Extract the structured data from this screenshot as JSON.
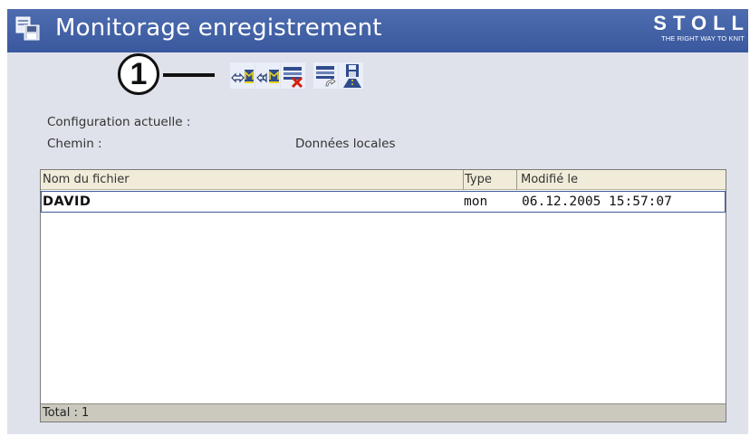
{
  "window": {
    "title": "Monitorage enregistrement",
    "icon": "record-monitor-icon",
    "brand": {
      "name": "STOLL",
      "slogan": "THE RIGHT WAY TO KNIT"
    }
  },
  "callout": {
    "number": "1"
  },
  "toolbar": {
    "buttons": [
      {
        "icon": "move-to-machine-icon"
      },
      {
        "icon": "move-from-machine-icon"
      },
      {
        "icon": "delete-list-icon"
      },
      {
        "icon": "list-refresh-icon"
      },
      {
        "icon": "save-to-disk-icon"
      }
    ]
  },
  "info": {
    "config_label": "Configuration actuelle :",
    "path_label": "Chemin :",
    "path_value": "Données locales"
  },
  "table": {
    "columns": [
      "Nom du fichier",
      "Type",
      "Modifié le"
    ],
    "rows": [
      {
        "name": "DAVID",
        "type": "mon",
        "modified": "06.12.2005 15:57:07"
      }
    ],
    "footer": "Total : 1"
  },
  "colors": {
    "titlebar": "#3a589d",
    "window_bg": "#dfe2ea",
    "header_bg": "#f1ecd9",
    "footer_bg": "#cbc8be",
    "selection_border": "#3e5a98"
  }
}
